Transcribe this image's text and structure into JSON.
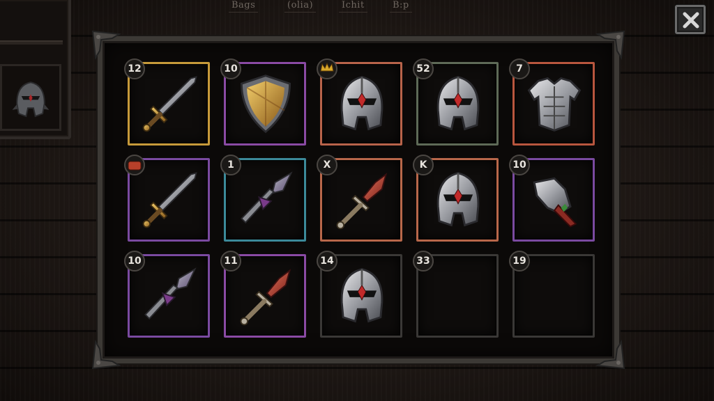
{
  "tabs": [
    "Bags",
    "(olia)",
    "Ichit",
    "B:p"
  ],
  "slots": [
    {
      "count": "12",
      "rarity": "#c79a3a",
      "icon": "sword-icon"
    },
    {
      "count": "10",
      "rarity": "#8a4aa4",
      "icon": "shield-icon"
    },
    {
      "count": "",
      "rarity": "#b8634a",
      "icon": "helmet-icon",
      "badge_icon": "crown-icon"
    },
    {
      "count": "52",
      "rarity": "#5e6a57",
      "icon": "helmet-icon"
    },
    {
      "count": "7",
      "rarity": "#b8563e",
      "icon": "chest-armor-icon"
    },
    {
      "count": "",
      "rarity": "#7a4aa0",
      "icon": "sword-icon",
      "badge_icon": "scroll-icon"
    },
    {
      "count": "1",
      "rarity": "#3c8a9a",
      "icon": "spear-icon"
    },
    {
      "count": "X",
      "rarity": "#b8674a",
      "icon": "dagger-icon"
    },
    {
      "count": "K",
      "rarity": "#b8674a",
      "icon": "helmet-icon"
    },
    {
      "count": "10",
      "rarity": "#7a4aa0",
      "icon": "gauntlet-icon"
    },
    {
      "count": "10",
      "rarity": "#7a4aa0",
      "icon": "spear-icon"
    },
    {
      "count": "11",
      "rarity": "#8a4aa4",
      "icon": "dagger-icon"
    },
    {
      "count": "14",
      "rarity": "#3a3836",
      "icon": "helmet-icon"
    },
    {
      "count": "33",
      "rarity": "#3a3836",
      "icon": ""
    },
    {
      "count": "19",
      "rarity": "#3a3836",
      "icon": ""
    }
  ],
  "side_slot": {
    "icon": "helmet-icon"
  },
  "close": {
    "icon": "close-icon"
  }
}
